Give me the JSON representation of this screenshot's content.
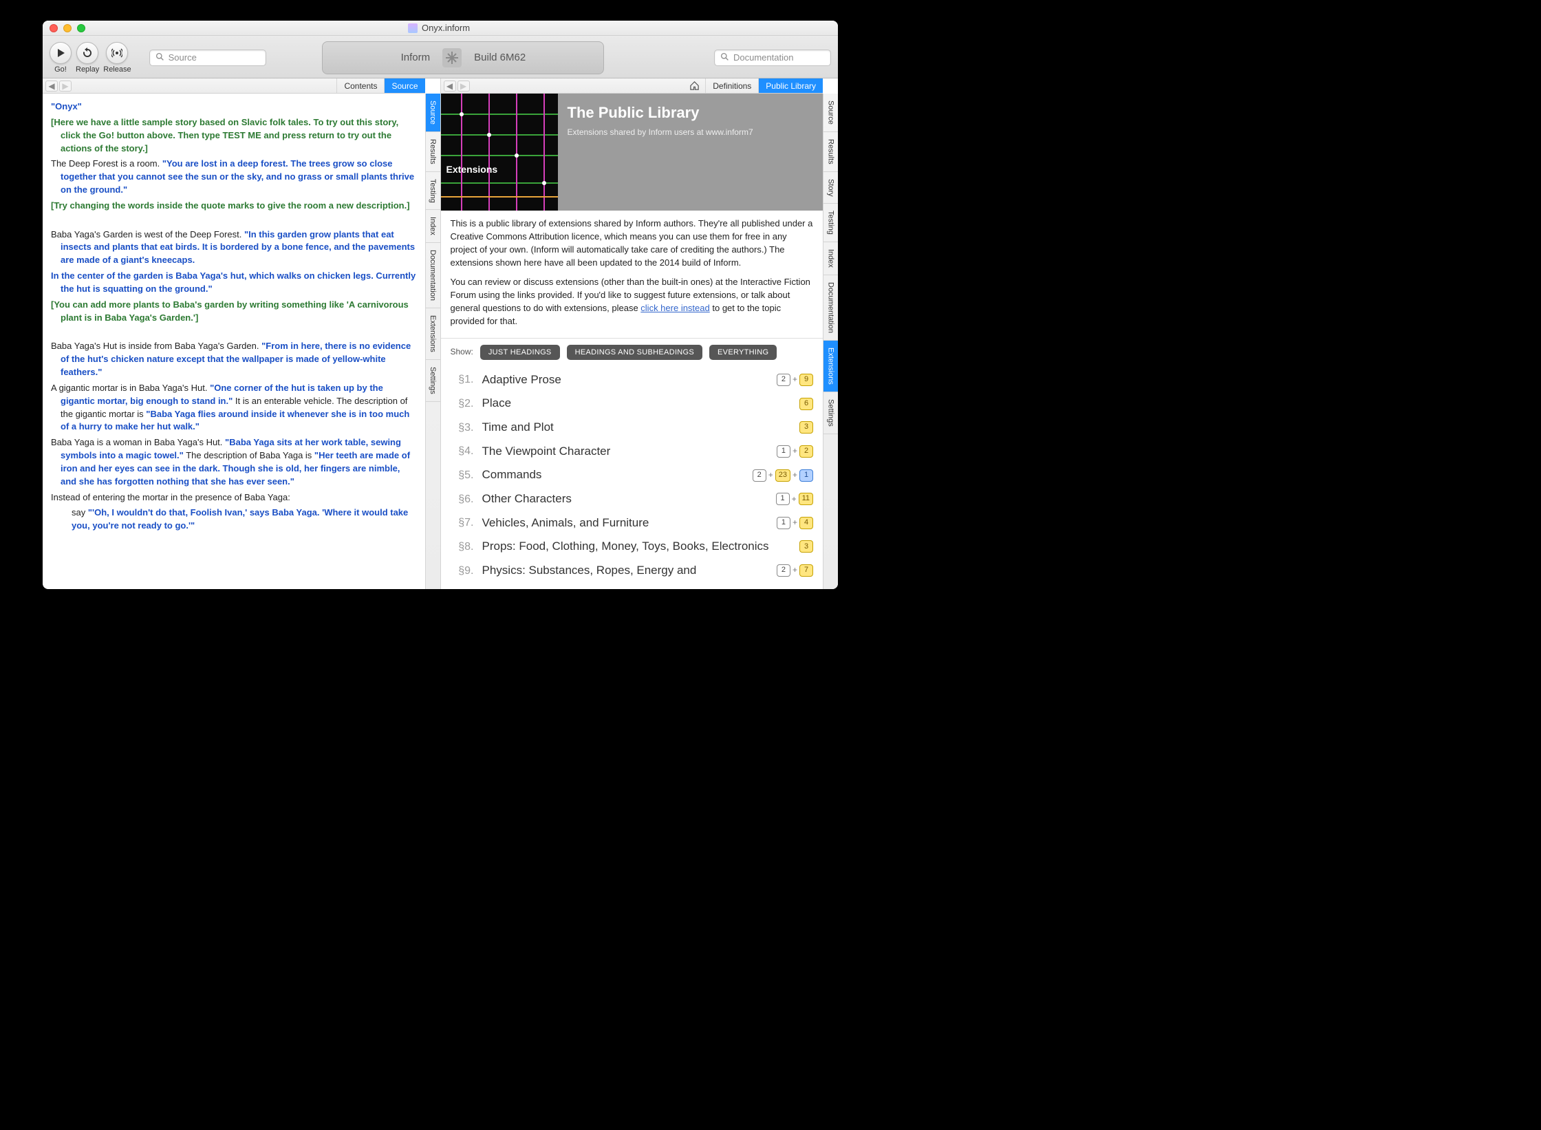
{
  "window": {
    "title": "Onyx.inform"
  },
  "toolbar": {
    "go": "Go!",
    "replay": "Replay",
    "release": "Release",
    "search_left_placeholder": "Source",
    "search_right_placeholder": "Documentation",
    "lozenge_left": "Inform",
    "lozenge_right": "Build 6M62"
  },
  "left": {
    "subtabs": {
      "contents": "Contents",
      "source": "Source"
    },
    "sidetabs": [
      "Source",
      "Results",
      "Testing",
      "Index",
      "Documentation",
      "Extensions",
      "Settings"
    ],
    "sidetab_selected": "Source",
    "source": {
      "title": "\"Onyx\"",
      "c1": "[Here we have a little sample story based on Slavic folk tales. To try out this story, click the Go! button above. Then type TEST ME and press return to try out the actions of the story.]",
      "p1a": "The Deep Forest is a room.",
      "p1q": "\"You are lost in a deep forest. The trees grow so close together that you cannot see the sun or the sky, and no grass or small plants thrive on the ground.\"",
      "c2": "[Try changing the words inside the quote marks to give the room a new description.]",
      "p2a": "Baba Yaga's Garden is west of the Deep Forest.",
      "p2q": "\"In this garden grow plants that eat insects and plants that eat birds. It is bordered by a bone fence, and the pavements are made of a giant's kneecaps.",
      "p3q": "In the center of the garden is Baba Yaga's hut, which walks on chicken legs. Currently the hut is squatting on the ground.\"",
      "c3": "[You can add more plants to Baba's garden by writing something like 'A carnivorous plant is in Baba Yaga's Garden.']",
      "p4a": "Baba Yaga's Hut is inside from Baba Yaga's Garden.",
      "p4q": "\"From in here, there is no evidence of the hut's chicken nature except that the wallpaper is made of yellow-white feathers.\"",
      "p5a": "A gigantic mortar is in Baba Yaga's Hut.",
      "p5q": "\"One corner of the hut is taken up by the gigantic mortar, big enough to stand in.\"",
      "p5b": " It is an enterable vehicle. The description of the gigantic mortar is ",
      "p5q2": "\"Baba Yaga flies around inside it whenever she is in too much of a hurry to make her hut walk.\"",
      "p6a": "Baba Yaga is a woman in Baba Yaga's Hut.",
      "p6q": "\"Baba Yaga sits at her work table, sewing symbols into a magic towel.\"",
      "p6b": " The description of Baba Yaga is ",
      "p6q2": "\"Her teeth are made of iron and her eyes can see in the dark. Though she is old, her fingers are nimble, and she has forgotten nothing that she has ever seen.\"",
      "p7a": "Instead of entering the mortar in the presence of Baba Yaga:",
      "p7b": "say ",
      "p7q": "\"'Oh, I wouldn't do that, Foolish Ivan,' says Baba Yaga. 'Where it would take you, you're not ready to go.'\""
    }
  },
  "right": {
    "subtabs": {
      "definitions": "Definitions",
      "public": "Public Library"
    },
    "sidetabs": [
      "Source",
      "Results",
      "Story",
      "Testing",
      "Index",
      "Documentation",
      "Extensions",
      "Settings"
    ],
    "sidetab_selected": "Extensions",
    "library": {
      "map_label": "Extensions",
      "heading": "The Public Library",
      "subtitle": "Extensions shared by Inform users at www.inform7",
      "para1": "This is a public library of extensions shared by Inform authors. They're all published under a Creative Commons Attribution licence, which means you can use them for free in any project of your own. (Inform will automatically take care of crediting the authors.) The extensions shown here have all been updated to the 2014 build of Inform.",
      "para2a": "You can review or discuss extensions (other than the built-in ones) at the Interactive Fiction Forum using the links provided. If you'd like to suggest future extensions, or talk about general questions to do with extensions, please ",
      "para2link": "click here instead",
      "para2b": " to get to the topic provided for that.",
      "show_label": "Show:",
      "chips": [
        "JUST HEADINGS",
        "HEADINGS AND SUBHEADINGS",
        "EVERYTHING"
      ],
      "sections": [
        {
          "num": "§1.",
          "title": "Adaptive Prose",
          "badges": [
            {
              "t": "2",
              "c": "white"
            },
            {
              "t": "+"
            },
            {
              "t": "9",
              "c": "yellow"
            }
          ]
        },
        {
          "num": "§2.",
          "title": "Place",
          "badges": [
            {
              "t": "6",
              "c": "yellow"
            }
          ]
        },
        {
          "num": "§3.",
          "title": "Time and Plot",
          "badges": [
            {
              "t": "3",
              "c": "yellow"
            }
          ]
        },
        {
          "num": "§4.",
          "title": "The Viewpoint Character",
          "badges": [
            {
              "t": "1",
              "c": "white"
            },
            {
              "t": "+"
            },
            {
              "t": "2",
              "c": "yellow"
            }
          ]
        },
        {
          "num": "§5.",
          "title": "Commands",
          "badges": [
            {
              "t": "2",
              "c": "white"
            },
            {
              "t": "+"
            },
            {
              "t": "23",
              "c": "yellow"
            },
            {
              "t": "+"
            },
            {
              "t": "1",
              "c": "blue"
            }
          ]
        },
        {
          "num": "§6.",
          "title": "Other Characters",
          "badges": [
            {
              "t": "1",
              "c": "white"
            },
            {
              "t": "+"
            },
            {
              "t": "11",
              "c": "yellow"
            }
          ]
        },
        {
          "num": "§7.",
          "title": "Vehicles, Animals, and Furniture",
          "badges": [
            {
              "t": "1",
              "c": "white"
            },
            {
              "t": "+"
            },
            {
              "t": "4",
              "c": "yellow"
            }
          ]
        },
        {
          "num": "§8.",
          "title": "Props: Food, Clothing, Money, Toys, Books, Electronics",
          "badges": [
            {
              "t": "3",
              "c": "yellow"
            }
          ]
        },
        {
          "num": "§9.",
          "title": "Physics: Substances, Ropes, Energy and",
          "badges": [
            {
              "t": "2",
              "c": "white"
            },
            {
              "t": "+"
            },
            {
              "t": "7",
              "c": "yellow"
            }
          ]
        }
      ]
    }
  }
}
